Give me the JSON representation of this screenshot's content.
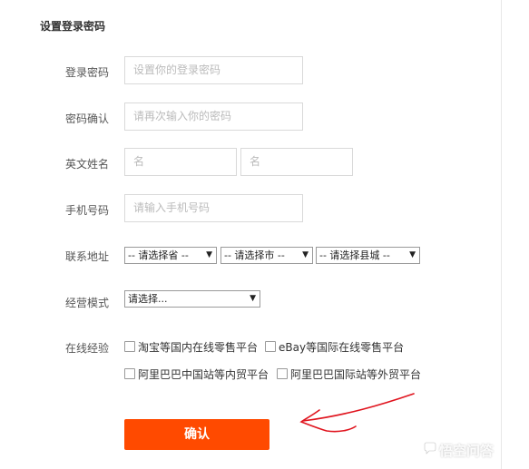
{
  "section_title": "设置登录密码",
  "fields": {
    "password": {
      "label": "登录密码",
      "placeholder": "设置你的登录密码"
    },
    "confirm_password": {
      "label": "密码确认",
      "placeholder": "请再次输入你的密码"
    },
    "english_name": {
      "label": "英文姓名",
      "first_placeholder": "名",
      "last_placeholder": "名"
    },
    "mobile": {
      "label": "手机号码",
      "placeholder": "请输入手机号码"
    },
    "address": {
      "label": "联系地址",
      "province": "-- 请选择省 --",
      "city": "-- 请选择市 --",
      "county": "-- 请选择县城 --"
    },
    "business_mode": {
      "label": "经营模式",
      "value": "请选择..."
    },
    "online_experience": {
      "label": "在线经验",
      "options": [
        "淘宝等国内在线零售平台",
        "eBay等国际在线零售平台",
        "阿里巴巴中国站等内贸平台",
        "阿里巴巴国际站等外贸平台"
      ]
    }
  },
  "confirm_button": "确认",
  "watermark": "悟空问答",
  "colors": {
    "accent": "#ff4a00",
    "annotation": "#e0141e"
  }
}
